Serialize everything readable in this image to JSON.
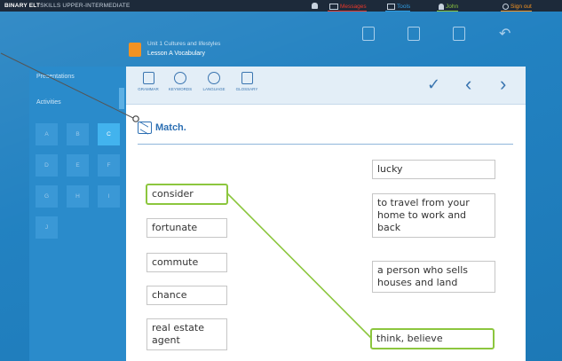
{
  "topbar": {
    "brand_bold": "BINARY ELT",
    "brand_rest": "SKILLS UPPER-INTERMEDIATE",
    "nav": [
      {
        "label": "Messages",
        "icon": "envelope-icon",
        "color": "#e8372a"
      },
      {
        "label": "Tools",
        "icon": "tools-icon",
        "color": "#2f9be0"
      },
      {
        "label": "John",
        "icon": "user-icon",
        "color": "#8cc63e"
      },
      {
        "label": "Sign out",
        "icon": "power-icon",
        "color": "#f29222"
      }
    ]
  },
  "unit": {
    "title": "Unit 1 Cultures and lifestyles",
    "lesson": "Lesson A Vocabulary"
  },
  "sidebar": {
    "items": [
      {
        "label": "Presentations"
      },
      {
        "label": "Activities"
      }
    ],
    "grid": [
      "A",
      "B",
      "C",
      "D",
      "E",
      "F",
      "G",
      "H",
      "I",
      "J"
    ],
    "active_cell": "C"
  },
  "toolbar": {
    "tools": [
      {
        "label": "GRAMMAR",
        "icon": "grammar-icon"
      },
      {
        "label": "KEYWORDS",
        "icon": "keywords-icon"
      },
      {
        "label": "LANGUAGE",
        "icon": "language-icon"
      },
      {
        "label": "GLOSSARY",
        "icon": "glossary-icon"
      }
    ],
    "check_glyph": "✓",
    "prev_glyph": "‹",
    "next_glyph": "›"
  },
  "activity": {
    "title": "Match.",
    "words": [
      "consider",
      "fortunate",
      "commute",
      "chance",
      "real estate agent"
    ],
    "definitions": [
      "lucky",
      "to travel from your home to work and back",
      "a person who sells houses and land",
      "think, believe"
    ],
    "selected_word": "consider",
    "selected_definition": "think, believe"
  },
  "colors": {
    "frame_blue": "#1e7fc0",
    "accent_green": "#8cc63e",
    "title_blue": "#2c6fb3"
  }
}
